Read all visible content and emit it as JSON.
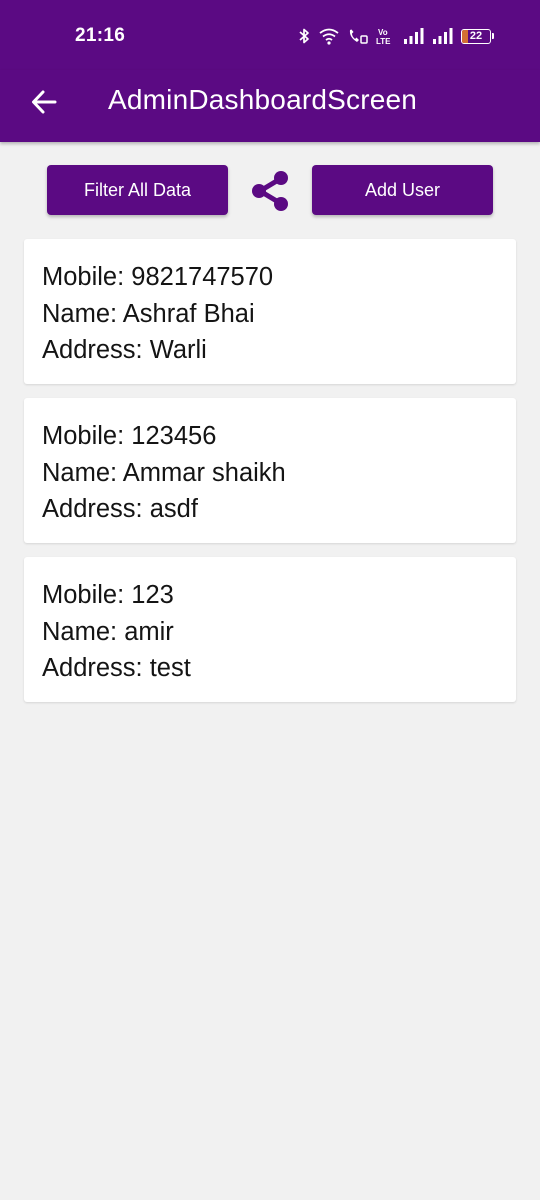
{
  "status_bar": {
    "time": "21:16",
    "volte_label": "Vo LTE",
    "battery_level": "22"
  },
  "app_bar": {
    "title": "AdminDashboardScreen"
  },
  "toolbar": {
    "filter_label": "Filter All Data",
    "add_user_label": "Add User"
  },
  "users": [
    {
      "mobile": "Mobile: 9821747570",
      "name": "Name: Ashraf Bhai",
      "address": "Address: Warli"
    },
    {
      "mobile": "Mobile: 123456",
      "name": "Name: Ammar shaikh",
      "address": "Address: asdf"
    },
    {
      "mobile": "Mobile: 123",
      "name": "Name: amir",
      "address": "Address: test"
    }
  ],
  "colors": {
    "primary": "#5b0a83",
    "background": "#f1f1f1",
    "card": "#ffffff"
  }
}
